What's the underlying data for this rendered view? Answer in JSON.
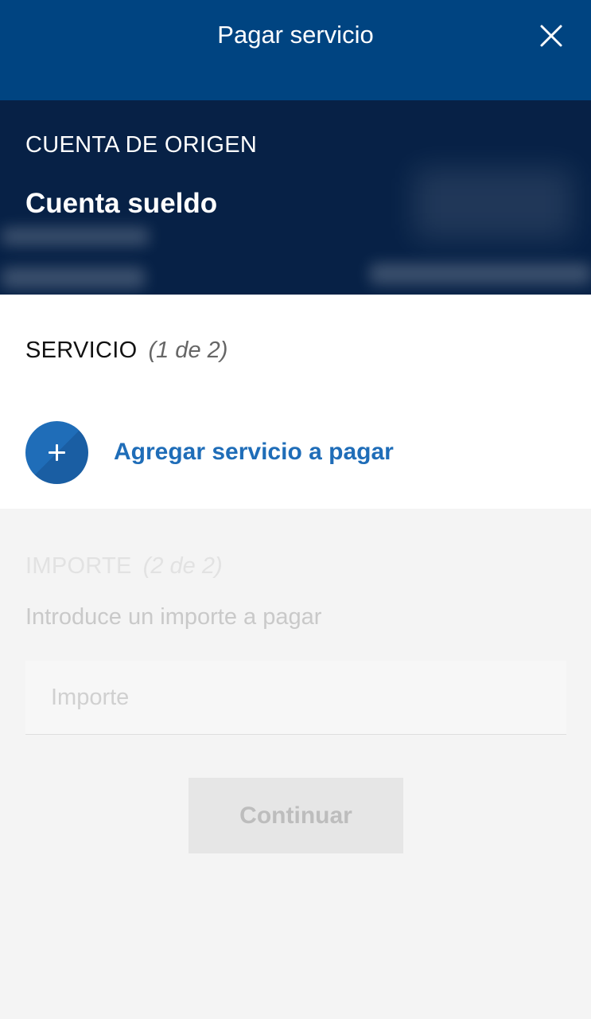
{
  "header": {
    "title": "Pagar servicio",
    "close_icon": "close-icon",
    "color": "#004481"
  },
  "account": {
    "label": "CUENTA DE ORIGEN",
    "name": "Cuenta sueldo",
    "color": "#072146"
  },
  "service": {
    "title": "SERVICIO",
    "step": "(1 de 2)",
    "add_label": "Agregar servicio a pagar",
    "add_icon": "plus-icon",
    "accent": "#1f6db8"
  },
  "amount": {
    "title": "IMPORTE",
    "step": "(2 de 2)",
    "hint": "Introduce un importe a pagar",
    "placeholder": "Importe",
    "value": ""
  },
  "actions": {
    "continue_label": "Continuar"
  }
}
